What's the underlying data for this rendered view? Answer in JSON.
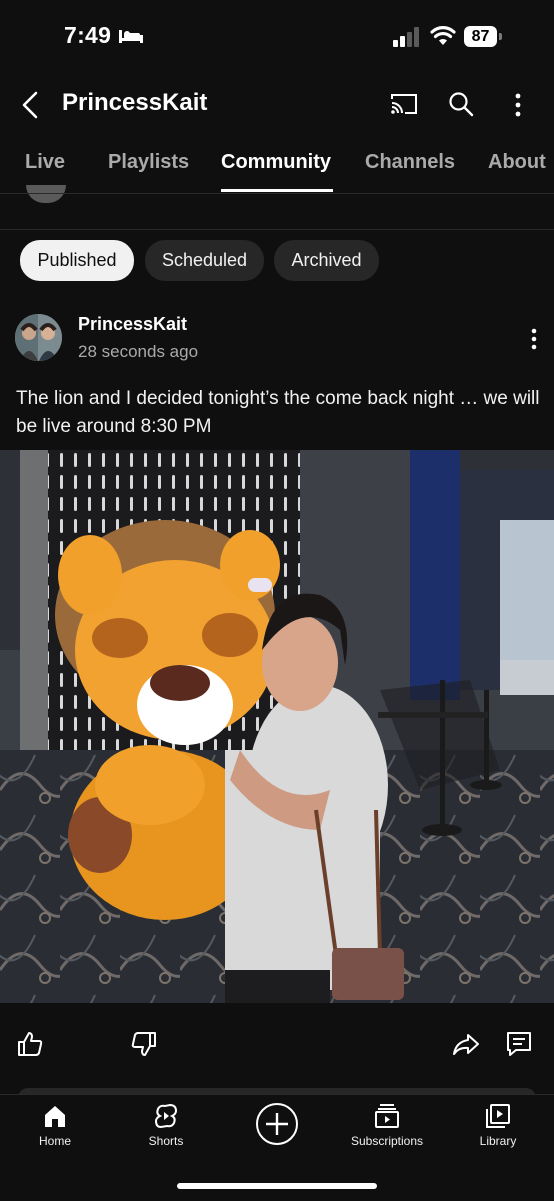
{
  "status_bar": {
    "time": "7:49",
    "battery": "87"
  },
  "header": {
    "title": "PrincessKait"
  },
  "tabs": [
    {
      "label": "Live"
    },
    {
      "label": "Playlists"
    },
    {
      "label": "Community"
    },
    {
      "label": "Channels"
    },
    {
      "label": "About"
    }
  ],
  "filters": [
    {
      "label": "Published"
    },
    {
      "label": "Scheduled"
    },
    {
      "label": "Archived"
    }
  ],
  "post": {
    "author": "PrincessKait",
    "time": "28 seconds ago",
    "text": "The lion and I decided tonight’s the come back night … we will be live around 8:30 PM"
  },
  "actions": {
    "like_icon": "thumbs-up-icon",
    "dislike_icon": "thumbs-down-icon",
    "share_icon": "share-icon",
    "comment_icon": "comment-icon"
  },
  "bottom_nav": [
    {
      "label": "Home",
      "icon": "home-icon"
    },
    {
      "label": "Shorts",
      "icon": "shorts-icon"
    },
    {
      "label": "",
      "icon": "create-plus-icon"
    },
    {
      "label": "Subscriptions",
      "icon": "subscriptions-icon"
    },
    {
      "label": "Library",
      "icon": "library-icon"
    }
  ],
  "colors": {
    "background": "#0f0f0f",
    "chip_active": "#f1f1f1",
    "chip_inactive": "#272727",
    "secondary_text": "#aaaaaa"
  }
}
